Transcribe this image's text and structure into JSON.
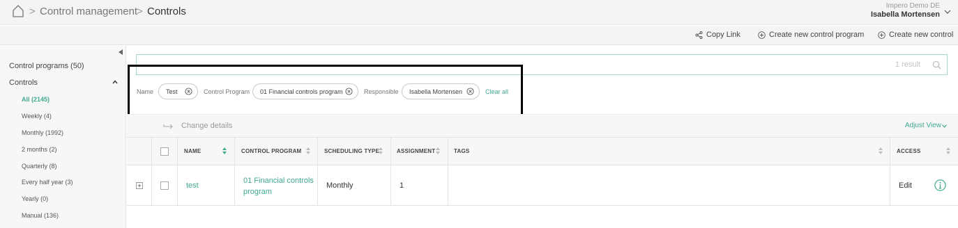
{
  "header": {
    "breadcrumb": [
      "Control management",
      "Controls"
    ],
    "separator": ">",
    "org": "Impero Demo DE",
    "user": "Isabella Mortensen"
  },
  "actions": {
    "copy_link": "Copy Link",
    "create_program": "Create new control program",
    "create_control": "Create new control"
  },
  "sidebar": {
    "control_programs": "Control programs (50)",
    "controls": "Controls",
    "items": [
      {
        "label": "All (2145)",
        "active": true
      },
      {
        "label": "Weekly (4)"
      },
      {
        "label": "Monthly (1992)"
      },
      {
        "label": "2 months (2)"
      },
      {
        "label": "Quarterly (8)"
      },
      {
        "label": "Every half year (3)"
      },
      {
        "label": "Yearly (0)"
      },
      {
        "label": "Manual (136)"
      }
    ]
  },
  "search": {
    "value": "",
    "result_count": "1 result"
  },
  "filters": {
    "name_label": "Name",
    "name_value": "Test",
    "program_label": "Control Program",
    "program_value": "01 Financial controls program",
    "responsible_label": "Responsible",
    "responsible_value": "Isabella Mortensen",
    "clear_all": "Clear all"
  },
  "toolbar": {
    "change_details": "Change details",
    "adjust_view": "Adjust View"
  },
  "table": {
    "columns": [
      "NAME",
      "CONTROL PROGRAM",
      "SCHEDULING TYPE",
      "ASSIGNMENT",
      "TAGS",
      "ACCESS"
    ],
    "rows": [
      {
        "name": "test",
        "program_line1": "01 Financial controls",
        "program_line2": "program",
        "scheduling": "Monthly",
        "assignment": "1",
        "tags": "",
        "access": "Edit"
      }
    ]
  },
  "colors": {
    "accent": "#3fa98f",
    "highlight_border": "#000000"
  }
}
